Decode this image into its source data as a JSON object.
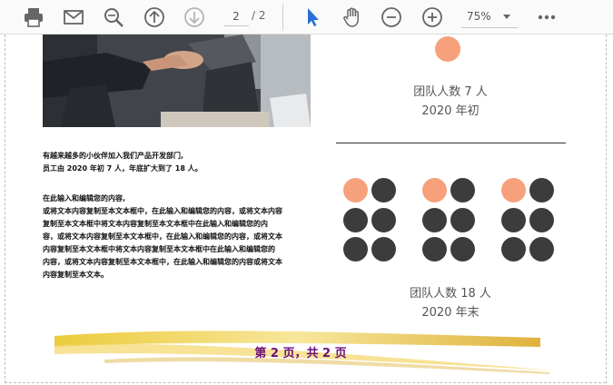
{
  "toolbar": {
    "current_page": "2",
    "total_pages": "/ 2",
    "zoom": "75%",
    "icons": [
      "printer-icon",
      "mail-icon",
      "search-icon",
      "page-up-icon",
      "page-down-icon",
      "select-cursor-icon",
      "hand-icon",
      "zoom-out-icon",
      "zoom-in-icon",
      "more-icon"
    ]
  },
  "left": {
    "intro_line1": "有越来越多的小伙伴加入我们产品开发部门,",
    "intro_line2": "员工由 2020 年初 7 人，年底扩大到了 18 人。",
    "body_lines": [
      "在此输入和编辑您的内容,",
      "或将文本内容复制至本文本框中，在此输入和编辑您的内容，或将文本内容",
      "复制至本文本框中将文本内容复制至本文本框中在此输入和编辑您的内",
      "容，或将文本内容复制至本文本框中，在此输入和编辑您的内容，或将文本",
      "内容复制至本文本框中将文本内容复制至本文本框中在此输入和编辑您的",
      "内容，或将文本内容复制至本文本框中，在此输入和编辑您的内容或将文本",
      "内容复制至本文本。"
    ]
  },
  "right": {
    "stat1_label": "团队人数 7 人",
    "stat1_date": "2020 年初",
    "stat2_label": "团队人数 18 人",
    "stat2_date": "2020 年末"
  },
  "footer": {
    "page_text": "第 2 页，共 2 页"
  },
  "colors": {
    "accent_orange": "#f7a07c",
    "dark_dot": "#3c3c3c",
    "footer_purple": "#6a0f7a",
    "icon_blue": "#2a6fd6"
  }
}
